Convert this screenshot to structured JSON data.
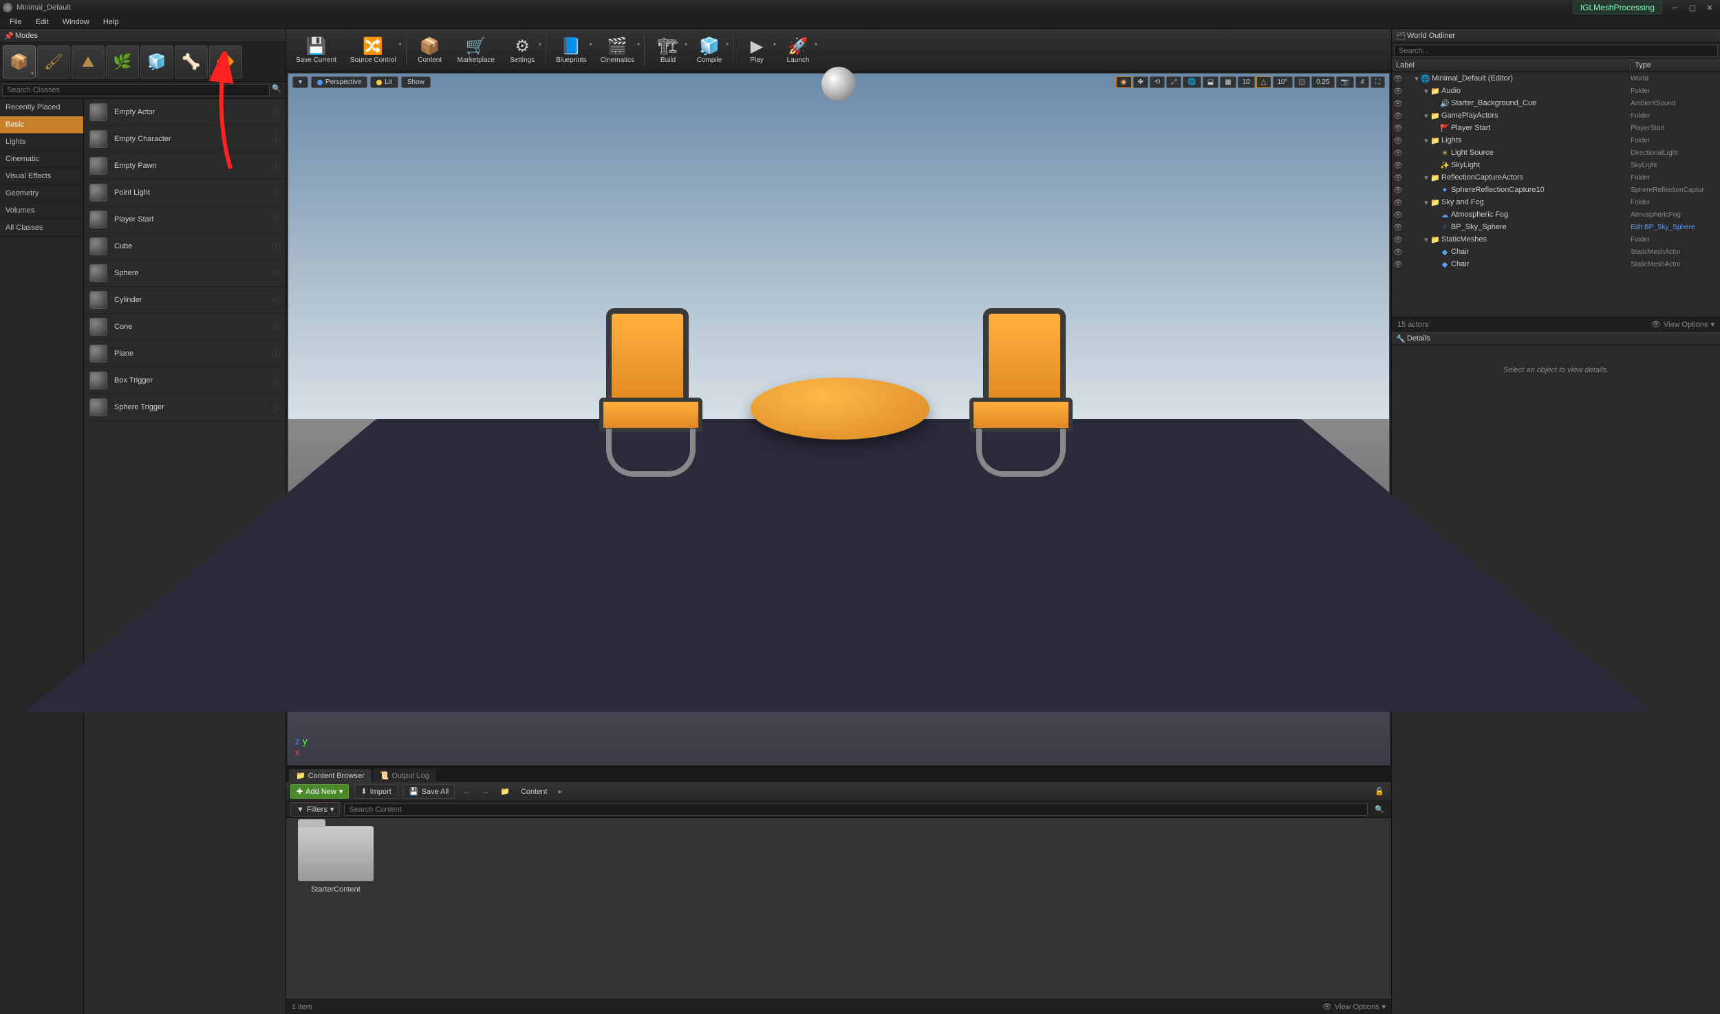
{
  "titlebar": {
    "level_name": "Minimal_Default",
    "plugin_name": "IGLMeshProcessing"
  },
  "menubar": [
    "File",
    "Edit",
    "Window",
    "Help"
  ],
  "modes_panel": {
    "title": "Modes",
    "search_placeholder": "Search Classes",
    "categories": [
      "Recently Placed",
      "Basic",
      "Lights",
      "Cinematic",
      "Visual Effects",
      "Geometry",
      "Volumes",
      "All Classes"
    ],
    "active_category": "Basic",
    "items": [
      "Empty Actor",
      "Empty Character",
      "Empty Pawn",
      "Point Light",
      "Player Start",
      "Cube",
      "Sphere",
      "Cylinder",
      "Cone",
      "Plane",
      "Box Trigger",
      "Sphere Trigger"
    ]
  },
  "toolbar": [
    {
      "label": "Save Current",
      "icon": "💾"
    },
    {
      "label": "Source Control",
      "icon": "🔀",
      "drop": true
    },
    {
      "label": "Content",
      "icon": "📦"
    },
    {
      "label": "Marketplace",
      "icon": "🛒"
    },
    {
      "label": "Settings",
      "icon": "⚙",
      "drop": true
    },
    {
      "label": "Blueprints",
      "icon": "📘",
      "drop": true
    },
    {
      "label": "Cinematics",
      "icon": "🎬",
      "drop": true
    },
    {
      "label": "Build",
      "icon": "🏗",
      "drop": true
    },
    {
      "label": "Compile",
      "icon": "🧊",
      "drop": true
    },
    {
      "label": "Play",
      "icon": "▶",
      "drop": true
    },
    {
      "label": "Launch",
      "icon": "🚀",
      "drop": true
    }
  ],
  "viewport": {
    "perspective": "Perspective",
    "lit": "Lit",
    "show": "Show",
    "grid_snap": "10",
    "angle_snap": "10°",
    "scale_snap": "0.25",
    "cam_speed": "4"
  },
  "content_browser": {
    "tab1": "Content Browser",
    "tab2": "Output Log",
    "add_new": "Add New",
    "import": "Import",
    "save_all": "Save All",
    "breadcrumb": "Content",
    "filters": "Filters",
    "search_placeholder": "Search Content",
    "folder": "StarterContent",
    "status": "1 item",
    "view_options": "View Options"
  },
  "outliner": {
    "title": "World Outliner",
    "search_placeholder": "Search...",
    "col_label": "Label",
    "col_type": "Type",
    "rows": [
      {
        "depth": 0,
        "exp": "▾",
        "icon": "🌐",
        "iclass": "ic-orange",
        "label": "Minimal_Default (Editor)",
        "type": "World"
      },
      {
        "depth": 1,
        "exp": "▾",
        "icon": "📁",
        "iclass": "ic-folder",
        "label": "Audio",
        "type": "Folder"
      },
      {
        "depth": 2,
        "exp": "",
        "icon": "🔊",
        "iclass": "ic-yellow",
        "label": "Starter_Background_Cue",
        "type": "AmbientSound"
      },
      {
        "depth": 1,
        "exp": "▾",
        "icon": "📁",
        "iclass": "ic-folder",
        "label": "GamePlayActors",
        "type": "Folder"
      },
      {
        "depth": 2,
        "exp": "",
        "icon": "🚩",
        "iclass": "ic-blue",
        "label": "Player Start",
        "type": "PlayerStart"
      },
      {
        "depth": 1,
        "exp": "▾",
        "icon": "📁",
        "iclass": "ic-folder",
        "label": "Lights",
        "type": "Folder"
      },
      {
        "depth": 2,
        "exp": "",
        "icon": "☀",
        "iclass": "ic-yellow",
        "label": "Light Source",
        "type": "DirectionalLight"
      },
      {
        "depth": 2,
        "exp": "",
        "icon": "✨",
        "iclass": "ic-yellow",
        "label": "SkyLight",
        "type": "SkyLight"
      },
      {
        "depth": 1,
        "exp": "▾",
        "icon": "📁",
        "iclass": "ic-folder",
        "label": "ReflectionCaptureActors",
        "type": "Folder"
      },
      {
        "depth": 2,
        "exp": "",
        "icon": "●",
        "iclass": "ic-blue",
        "label": "SphereReflectionCapture10",
        "type": "SphereReflectionCaptur"
      },
      {
        "depth": 1,
        "exp": "▾",
        "icon": "📁",
        "iclass": "ic-folder",
        "label": "Sky and Fog",
        "type": "Folder"
      },
      {
        "depth": 2,
        "exp": "",
        "icon": "☁",
        "iclass": "ic-blue",
        "label": "Atmospheric Fog",
        "type": "AtmosphericFog"
      },
      {
        "depth": 2,
        "exp": "",
        "icon": "○",
        "iclass": "ic-blue",
        "label": "BP_Sky_Sphere",
        "type": "Edit BP_Sky_Sphere",
        "link": true
      },
      {
        "depth": 1,
        "exp": "▾",
        "icon": "📁",
        "iclass": "ic-folder",
        "label": "StaticMeshes",
        "type": "Folder"
      },
      {
        "depth": 2,
        "exp": "",
        "icon": "◆",
        "iclass": "ic-blue",
        "label": "Chair",
        "type": "StaticMeshActor"
      },
      {
        "depth": 2,
        "exp": "",
        "icon": "◆",
        "iclass": "ic-blue",
        "label": "Chair",
        "type": "StaticMeshActor"
      }
    ],
    "actor_count": "15 actors",
    "view_options": "View Options"
  },
  "details": {
    "title": "Details",
    "empty_msg": "Select an object to view details."
  }
}
